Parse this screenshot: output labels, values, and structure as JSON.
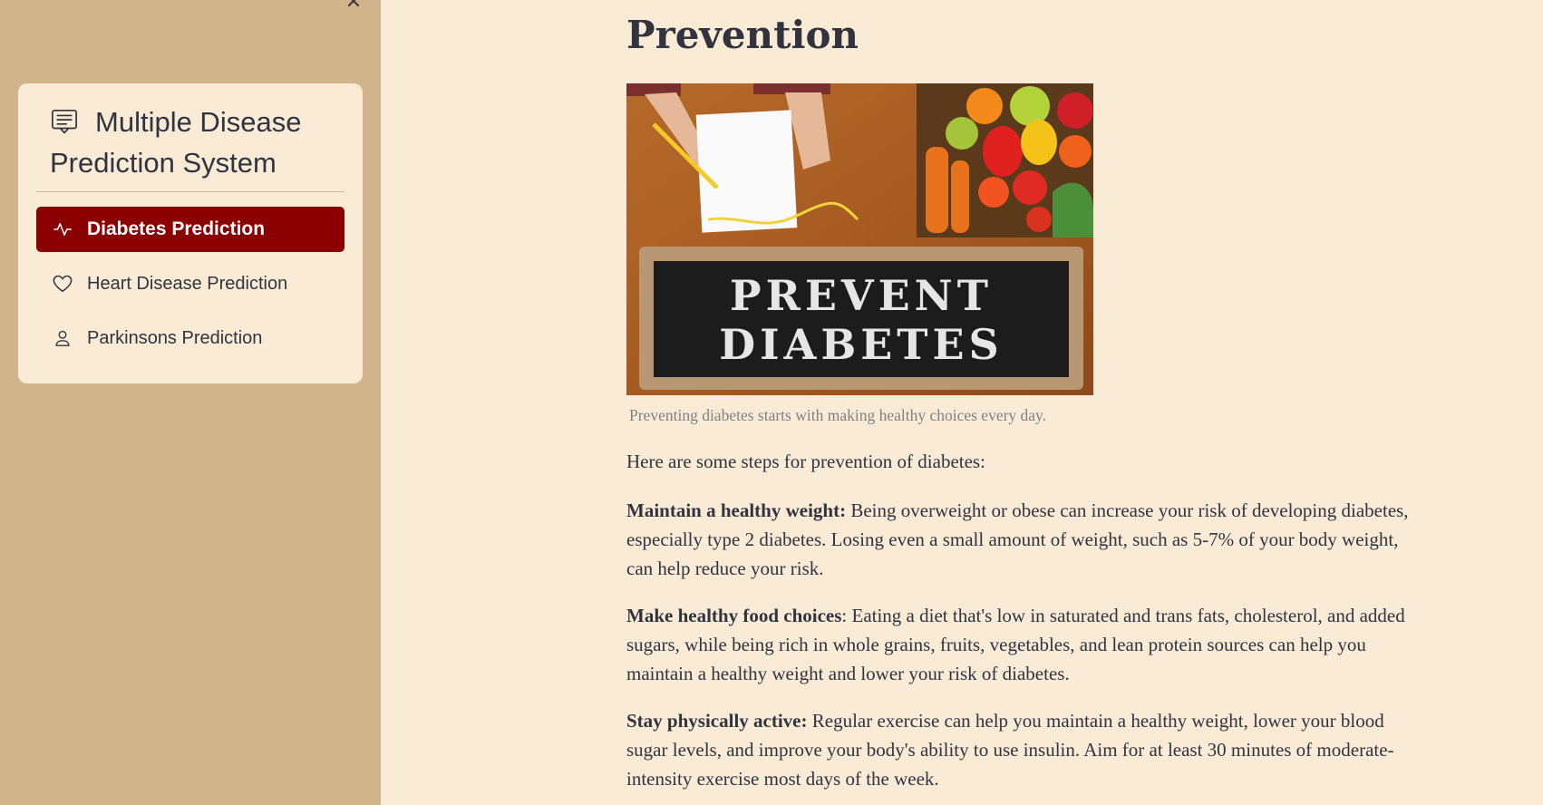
{
  "sidebar": {
    "close_icon": "close-icon",
    "menu_title": "Multiple Disease Prediction System",
    "menu_icon": "chat-square-text-icon",
    "items": [
      {
        "label": "Diabetes Prediction",
        "icon": "activity-icon",
        "active": true
      },
      {
        "label": "Heart Disease Prediction",
        "icon": "heart-icon",
        "active": false
      },
      {
        "label": "Parkinsons Prediction",
        "icon": "person-icon",
        "active": false
      }
    ],
    "colors": {
      "sidebar_bg": "#d2b48c",
      "card_bg": "#faebd7",
      "active_bg": "#8b0000"
    }
  },
  "main": {
    "title": "Prevention",
    "image": {
      "line1": "PREVENT",
      "line2": "DIABETES"
    },
    "caption": "Preventing diabetes starts with making healthy choices every day.",
    "intro": "Here are some steps for prevention of diabetes:",
    "tips": [
      {
        "heading": "Maintain a healthy weight:",
        "text": " Being overweight or obese can increase your risk of developing diabetes, especially type 2 diabetes. Losing even a small amount of weight, such as 5-7% of your body weight, can help reduce your risk."
      },
      {
        "heading": "Make healthy food choices",
        "text": ": Eating a diet that's low in saturated and trans fats, cholesterol, and added sugars, while being rich in whole grains, fruits, vegetables, and lean protein sources can help you maintain a healthy weight and lower your risk of diabetes."
      },
      {
        "heading": "Stay physically active:",
        "text": " Regular exercise can help you maintain a healthy weight, lower your blood sugar levels, and improve your body's ability to use insulin. Aim for at least 30 minutes of moderate-intensity exercise most days of the week."
      }
    ],
    "page_bg": "#faebd7"
  }
}
